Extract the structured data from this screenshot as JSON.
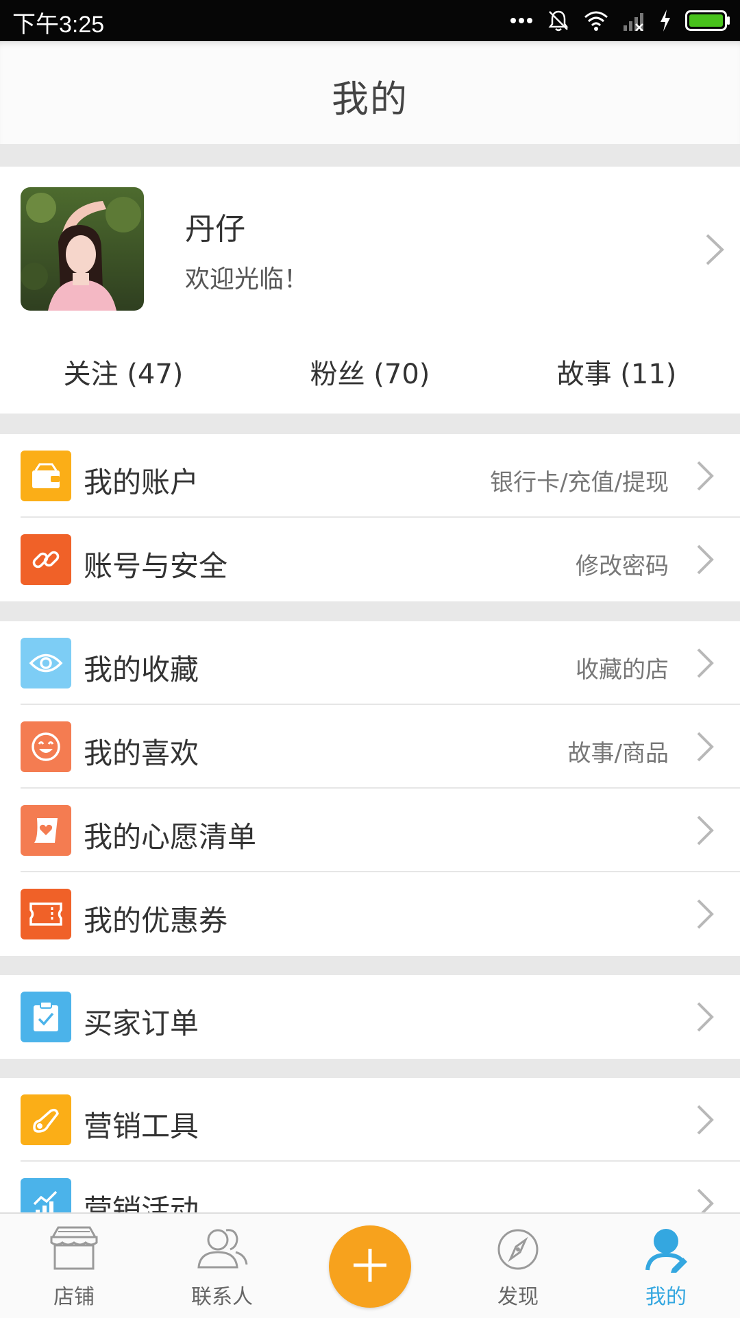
{
  "status_bar": {
    "time": "下午3:25"
  },
  "header": {
    "title": "我的"
  },
  "profile": {
    "name": "丹仔",
    "welcome": "欢迎光临！",
    "stats": [
      {
        "label": "关注 (47)"
      },
      {
        "label": "粉丝 (70)"
      },
      {
        "label": "故事 (11)"
      }
    ]
  },
  "groups": [
    {
      "items": [
        {
          "label": "我的账户",
          "sub": "银行卡/充值/提现",
          "icon": "wallet-icon",
          "color": "#fbae17"
        },
        {
          "label": "账号与安全",
          "sub": "修改密码",
          "icon": "link-icon",
          "color": "#f06128"
        }
      ]
    },
    {
      "items": [
        {
          "label": "我的收藏",
          "sub": "收藏的店",
          "icon": "eye-icon",
          "color": "#7dcdf5"
        },
        {
          "label": "我的喜欢",
          "sub": "故事/商品",
          "icon": "smiley-icon",
          "color": "#f47c51"
        },
        {
          "label": "我的心愿清单",
          "sub": "",
          "icon": "wishlist-icon",
          "color": "#f47c51"
        },
        {
          "label": "我的优惠券",
          "sub": "",
          "icon": "coupon-icon",
          "color": "#f06128"
        }
      ]
    },
    {
      "items": [
        {
          "label": "买家订单",
          "sub": "",
          "icon": "clipboard-check-icon",
          "color": "#4bb3ea"
        }
      ]
    },
    {
      "items": [
        {
          "label": "营销工具",
          "sub": "",
          "icon": "megaphone-icon",
          "color": "#fbae17"
        },
        {
          "label": "营销活动",
          "sub": "",
          "icon": "chart-up-icon",
          "color": "#4bb3ea"
        }
      ]
    }
  ],
  "tabs": [
    {
      "label": "店铺",
      "icon": "store-icon"
    },
    {
      "label": "联系人",
      "icon": "contacts-icon"
    },
    {
      "label": "",
      "icon": "plus-icon"
    },
    {
      "label": "发现",
      "icon": "compass-icon"
    },
    {
      "label": "我的",
      "icon": "profile-icon",
      "active": true
    }
  ],
  "colors": {
    "accent": "#34a7e0",
    "add_button": "#f7a21d"
  }
}
